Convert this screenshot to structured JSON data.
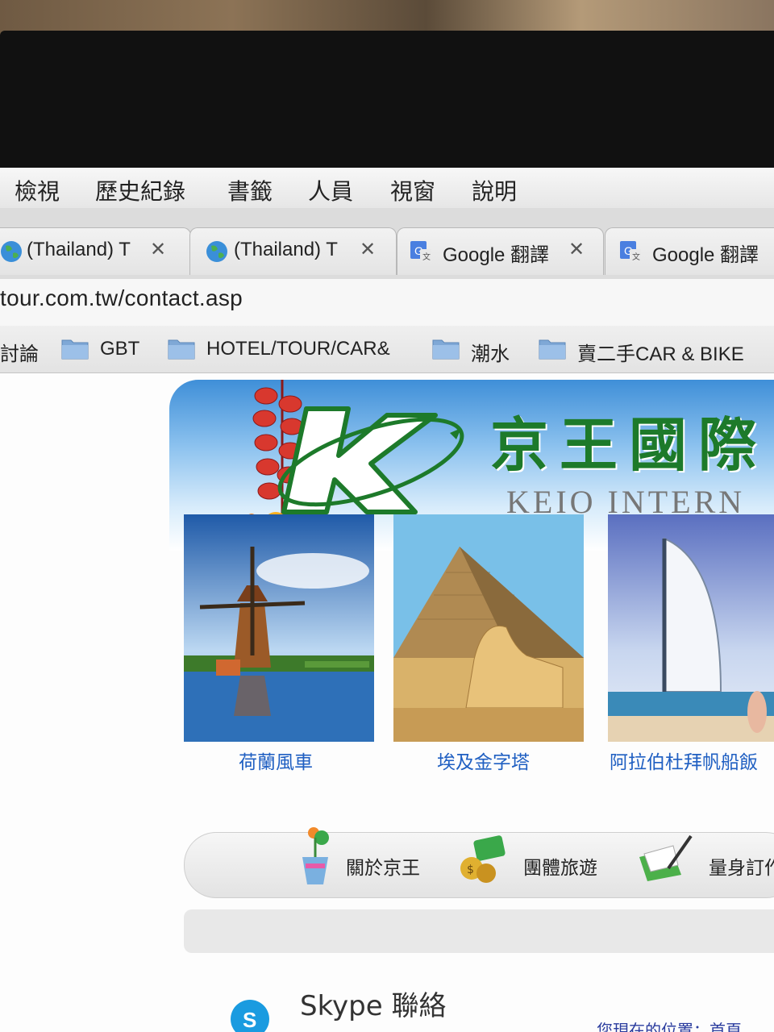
{
  "menu": {
    "items": [
      "檢視",
      "歷史紀錄",
      "書籤",
      "人員",
      "視窗",
      "說明"
    ]
  },
  "tabs": [
    {
      "label": "(Thailand) T",
      "icon": "globe-icon",
      "close": "✕"
    },
    {
      "label": "(Thailand) T",
      "icon": "globe-icon",
      "close": "✕"
    },
    {
      "label": "Google 翻譯",
      "icon": "google-translate-icon",
      "close": "✕"
    },
    {
      "label": "Google 翻譯",
      "icon": "google-translate-icon"
    }
  ],
  "address_bar": {
    "url": "tour.com.tw/contact.asp"
  },
  "bookmarks": {
    "first_partial": "討論",
    "items": [
      {
        "label": "GBT",
        "icon": "folder-icon"
      },
      {
        "label": "HOTEL/TOUR/CAR&",
        "icon": "folder-icon"
      },
      {
        "label": "潮水",
        "icon": "folder-icon"
      },
      {
        "label": "賣二手CAR & BIKE",
        "icon": "folder-icon"
      }
    ]
  },
  "banner": {
    "company_cn": "京王國際",
    "company_en": "KEIO INTERN"
  },
  "destinations": [
    {
      "caption": "荷蘭風車",
      "image": "windmill-photo"
    },
    {
      "caption": "埃及金字塔",
      "image": "pyramid-photo"
    },
    {
      "caption": "阿拉伯杜拜帆船飯",
      "image": "burj-al-arab-photo"
    }
  ],
  "nav": {
    "items": [
      {
        "label": "關於京王",
        "icon": "flower-pot-icon"
      },
      {
        "label": "團體旅遊",
        "icon": "money-coins-icon"
      },
      {
        "label": "量身訂作",
        "icon": "pen-paper-icon"
      }
    ]
  },
  "footer": {
    "skype_title": "Skype 聯絡",
    "location_text": "您現在的位置：首頁"
  },
  "colors": {
    "brand_green": "#1d7a2a",
    "link_blue": "#1f5fc2",
    "sky_blue": "#3f8fd8"
  }
}
